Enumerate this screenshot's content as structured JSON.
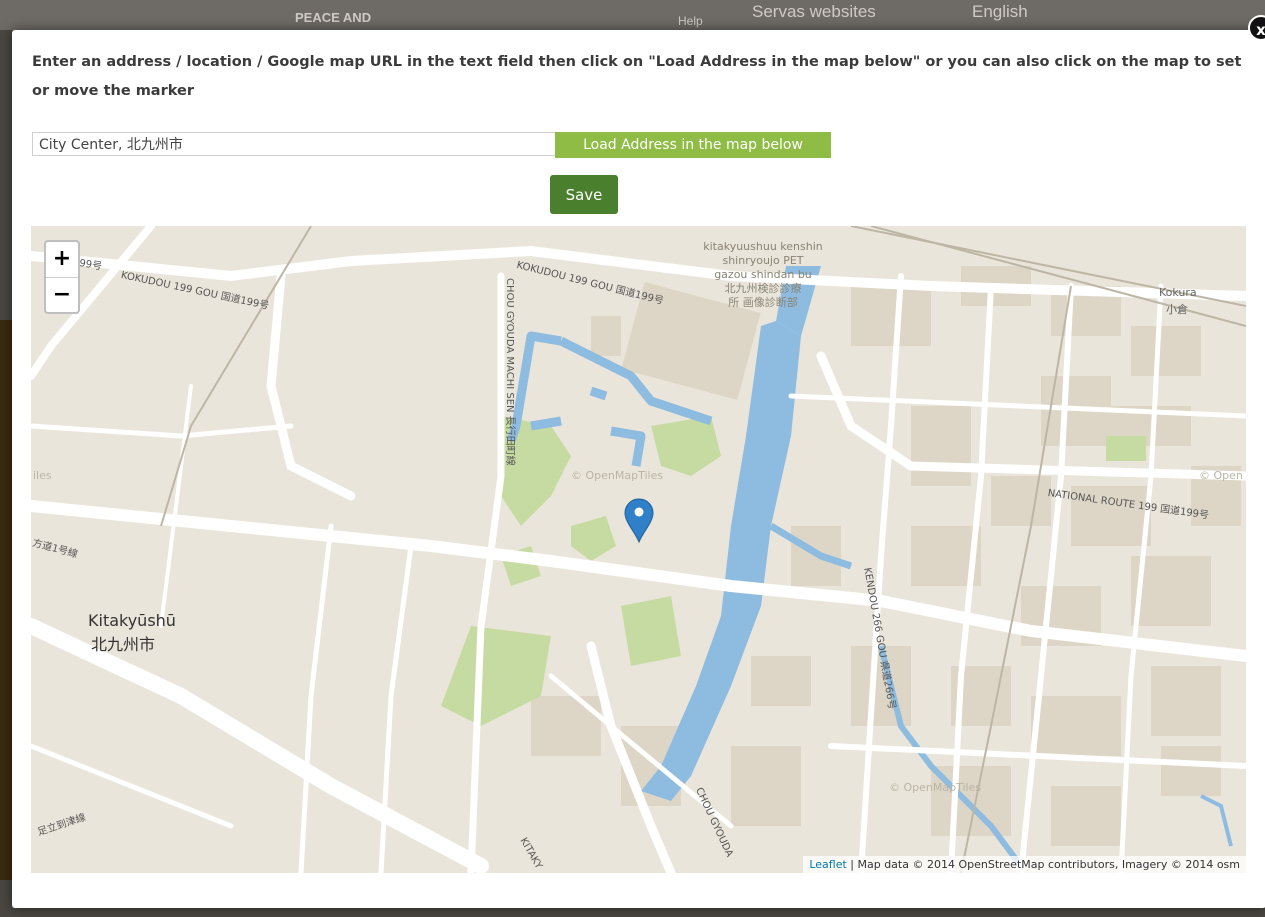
{
  "background_page": {
    "header_items": [
      "PEACE AND",
      "Help",
      "Servas websites",
      "English"
    ]
  },
  "dialog": {
    "close_label": "x",
    "instructions": "Enter an address / location / Google map URL in the text field then click on \"Load Address in the map below\" or you can also click on the map to set or move the marker",
    "address_input": {
      "value": "City Center, 北九州市",
      "placeholder": ""
    },
    "load_button_label": "Load Address in the map below",
    "save_button_label": "Save"
  },
  "map": {
    "zoom_in_label": "+",
    "zoom_out_label": "−",
    "attribution": {
      "leaflet": "Leaflet",
      "rest": " | Map data © 2014 OpenStreetMap contributors, Imagery © 2014 osm"
    },
    "labels": {
      "city_en": "Kitakyūshū",
      "city_ja": "北九州市",
      "kokura_en": "Kokura",
      "kokura_ja": "小倉",
      "poi": [
        "kitakyuushuu kenshin",
        "shinryoujo PET",
        "gazou shindan bu",
        "北九州検診診療",
        "所 画像診断部"
      ],
      "road_kokudou_left": "KOKUDOU 199 GOU 国道199号",
      "road_kokudou_top": "KOKUDOU 199 GOU 国道199号",
      "road_national": "NATIONAL ROUTE 199 国道199号",
      "road_chou_gyouda": "CHOU GYOUDA MACHI SEN 長行田町線",
      "road_kendou": "KENDOU 266 GOU 県道266号",
      "road_chou_gyouda_bottom": "CHOU GYOUDA",
      "road_left_ja": "方道1号線",
      "road_bottom_left_ja": "足立到津線",
      "road_kitaky": "KITAKY",
      "road_99": "99号",
      "omt_1": "© OpenMapTiles",
      "omt_2": "© OpenMapTiles",
      "omt_3": "© Open",
      "omt_4": "iles"
    }
  },
  "colors": {
    "load_button": "#8fbc45",
    "save_button": "#4a7f2e",
    "water": "#8ebce0",
    "land": "#eae5da",
    "park": "#c6dba1",
    "marker": "#2f7fc9"
  }
}
